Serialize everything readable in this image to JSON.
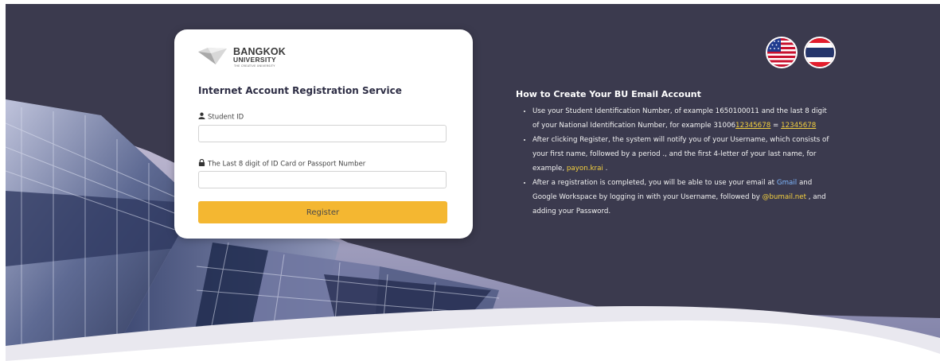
{
  "login_card": {
    "logo": {
      "name": "BANGKOK",
      "subname": "UNIVERSITY",
      "tagline": "THE CREATIVE UNIVERSITY",
      "icon": "diamond-logo-icon"
    },
    "title": "Internet Account Registration Service",
    "student_id": {
      "label": "Student ID",
      "icon": "user-icon",
      "value": "",
      "placeholder": ""
    },
    "id_card": {
      "label": "The Last 8 digit of ID Card or Passport Number",
      "icon": "lock-icon",
      "value": "",
      "placeholder": ""
    },
    "register_label": "Register"
  },
  "language": {
    "options": [
      "English (US flag)",
      "Thai (Thai flag)"
    ]
  },
  "instructions": {
    "title": "How to Create Your BU Email Account",
    "item1": {
      "t1": "Use your Student Identification Number, of example 1650100011 and the last 8 digit of your National Identification Number, for example 31006",
      "hl1": "12345678",
      "t2": " = ",
      "hl2": "12345678"
    },
    "item2": {
      "t1": "After clicking Register, the system will notify you of your Username, which consists of your first name, followed by a period ., and the first 4-letter of your last name, for example, ",
      "hl1": "payon.krai",
      "t2": " ."
    },
    "item3": {
      "t1": "After a registration is completed, you will be able to use your email at ",
      "link": "Gmail",
      "t2": " and Google Workspace by logging in with your Username, followed by ",
      "hl1": "@bumail.net",
      "t3": " , and adding your Password."
    }
  },
  "colors": {
    "background": "#3b3a4e",
    "accent_button": "#f4b731",
    "highlight": "#f4d03f",
    "link": "#7fb7ff"
  }
}
